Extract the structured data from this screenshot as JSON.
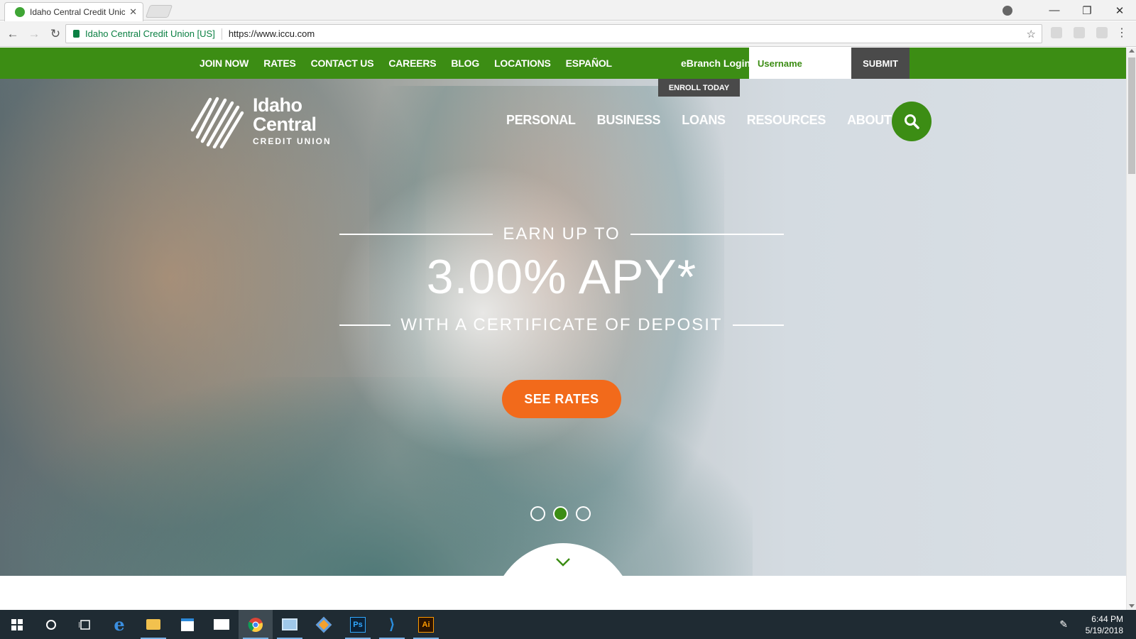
{
  "browser": {
    "tab_title": "Idaho Central Credit Unic",
    "tab_close": "✕",
    "site_identity": "Idaho Central Credit Union [US]",
    "url": "https://www.iccu.com",
    "window_controls": {
      "minimize": "—",
      "restore": "❐",
      "close": "✕"
    },
    "nav": {
      "back": "←",
      "forward": "→",
      "reload": "↻",
      "bookmark": "☆",
      "menu": "⋮"
    }
  },
  "utility_nav": {
    "links": [
      "JOIN NOW",
      "RATES",
      "CONTACT US",
      "CAREERS",
      "BLOG",
      "LOCATIONS",
      "ESPAÑOL"
    ],
    "ebranch_label": "eBranch Login",
    "username_placeholder": "Username",
    "submit_label": "SUBMIT",
    "enroll_label": "ENROLL TODAY"
  },
  "logo": {
    "line1": "Idaho",
    "line2": "Central",
    "line3": "CREDIT UNION"
  },
  "main_nav": {
    "items": [
      "PERSONAL",
      "BUSINESS",
      "LOANS",
      "RESOURCES",
      "ABOUT"
    ]
  },
  "hero": {
    "line1": "EARN UP TO",
    "headline": "3.00% APY*",
    "line3": "WITH A CERTIFICATE OF DEPOSIT",
    "cta_label": "SEE RATES",
    "slide_count": 3,
    "active_slide": 2
  },
  "taskbar": {
    "apps": [
      "windows-start",
      "cortana",
      "task-view",
      "edge",
      "file-explorer",
      "store",
      "mail",
      "chrome",
      "app",
      "git-client",
      "photoshop",
      "vscode",
      "illustrator"
    ],
    "time": "6:44 PM",
    "date": "5/19/2018"
  },
  "colors": {
    "brand_green": "#3c8d14",
    "cta_orange": "#f26a1b",
    "login_bg": "#4a4a4a"
  }
}
